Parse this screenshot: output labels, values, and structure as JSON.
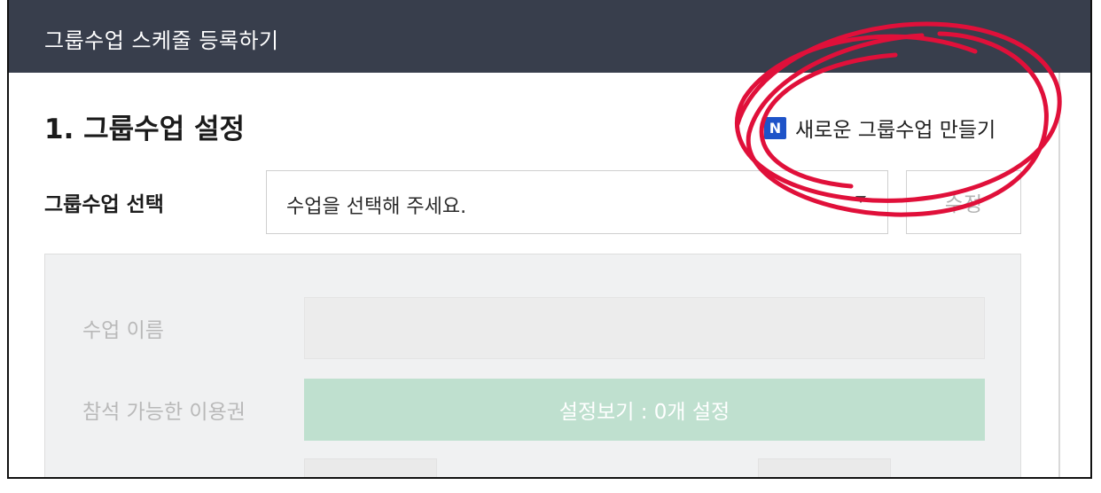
{
  "header": {
    "title": "그룹수업 스케줄 등록하기"
  },
  "section": {
    "title": "1. 그룹수업 설정"
  },
  "new_class": {
    "icon_letter": "N",
    "label": "새로운 그룹수업 만들기"
  },
  "class_select": {
    "label": "그룹수업 선택",
    "value": "수업을 선택해 주세요.",
    "edit_label": "수정"
  },
  "panel": {
    "class_name_label": "수업 이름",
    "pass_label": "참석 가능한 이용권",
    "pass_button": "설정보기 : 0개 설정"
  },
  "colors": {
    "header_bg": "#383e4c",
    "n_icon": "#1e53c8",
    "green_button": "#bfe0cf",
    "annotation_red": "#e0103a"
  }
}
